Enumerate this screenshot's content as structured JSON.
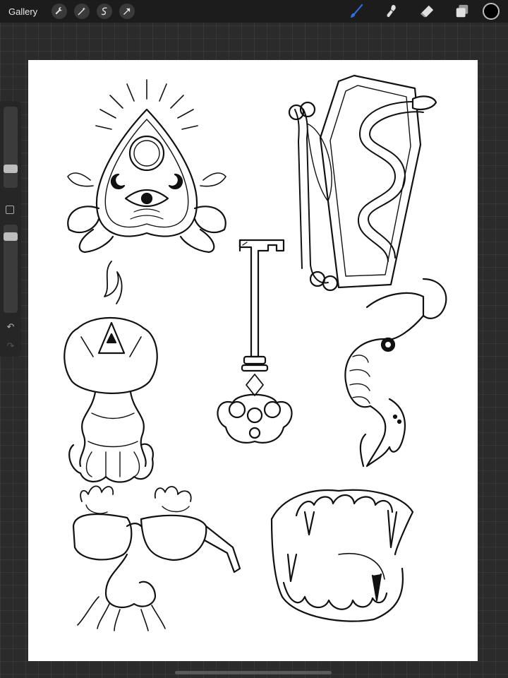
{
  "app": {
    "gallery_label": "Gallery"
  },
  "toolbar": {
    "left_tools": [
      "wrench-icon",
      "magic-wand-icon",
      "selection-icon",
      "transform-arrow-icon"
    ],
    "right_tools": [
      "brush-icon",
      "smudge-icon",
      "eraser-icon",
      "layers-icon"
    ],
    "active_tool": "brush-icon",
    "active_color": "#000000",
    "accent_color": "#2f6fe0"
  },
  "sidebar": {
    "brush_size_level": 0.45,
    "opacity_level": 0.1,
    "controls": [
      "brush-size-slider",
      "modify-button",
      "opacity-slider",
      "undo-icon",
      "redo-icon"
    ]
  },
  "canvas": {
    "background": "#ffffff",
    "drawings": [
      "planchette",
      "coffin-with-snake-and-bone",
      "skeleton-key",
      "pumpkin-candle",
      "raven-claw",
      "disguise-glasses",
      "vampire-teeth"
    ]
  }
}
